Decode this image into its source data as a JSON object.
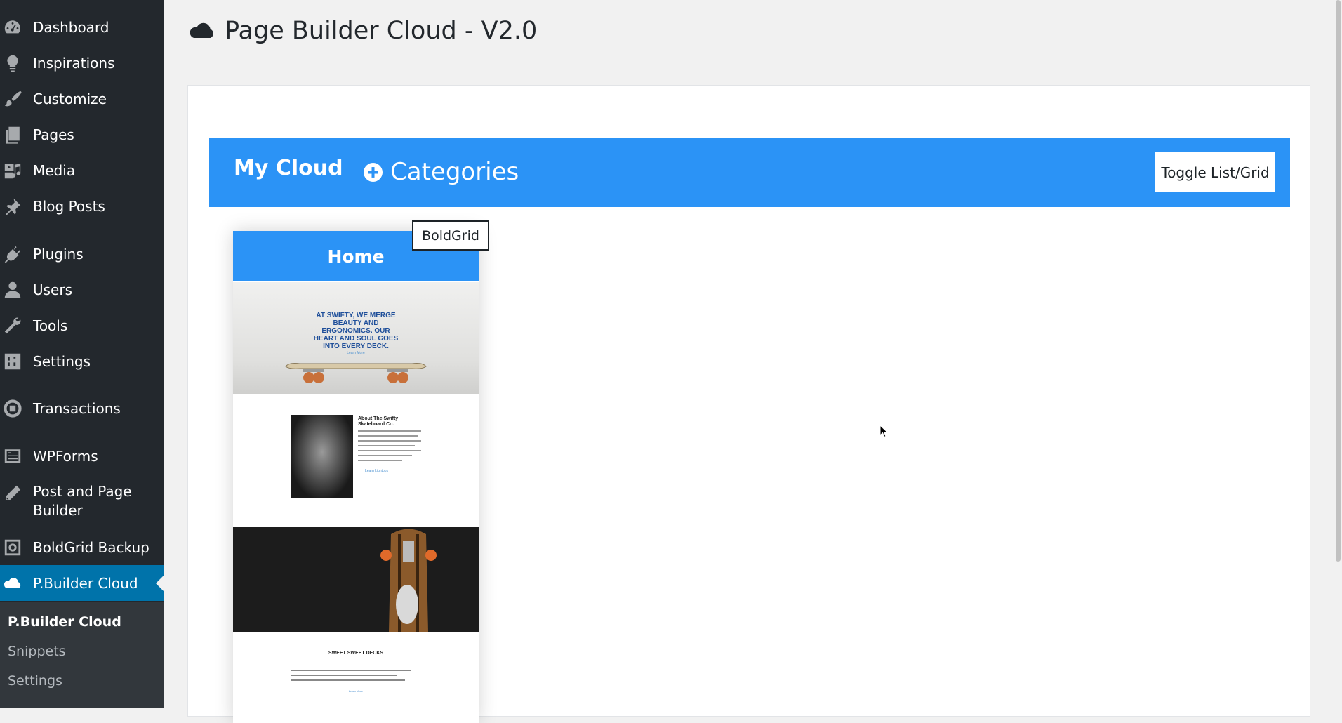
{
  "sidebar": {
    "items": [
      {
        "label": "Dashboard",
        "icon": "dashboard-icon"
      },
      {
        "label": "Inspirations",
        "icon": "lightbulb-icon"
      },
      {
        "label": "Customize",
        "icon": "brush-icon"
      },
      {
        "label": "Pages",
        "icon": "pages-icon"
      },
      {
        "label": "Media",
        "icon": "media-icon"
      },
      {
        "label": "Blog Posts",
        "icon": "pin-icon"
      },
      {
        "label": "Plugins",
        "icon": "plug-icon"
      },
      {
        "label": "Users",
        "icon": "users-icon"
      },
      {
        "label": "Tools",
        "icon": "wrench-icon"
      },
      {
        "label": "Settings",
        "icon": "settings-icon"
      },
      {
        "label": "Transactions",
        "icon": "transactions-icon"
      },
      {
        "label": "WPForms",
        "icon": "forms-icon"
      },
      {
        "label": "Post and Page Builder",
        "label_line1": "Post and Page",
        "label_line2": "Builder",
        "icon": "pencil-icon"
      },
      {
        "label": "BoldGrid Backup",
        "icon": "backup-icon"
      },
      {
        "label": "P.Builder Cloud",
        "icon": "cloud-icon",
        "active": true
      }
    ],
    "submenu": [
      {
        "label": "P.Builder Cloud",
        "current": true
      },
      {
        "label": "Snippets"
      },
      {
        "label": "Settings"
      }
    ]
  },
  "header": {
    "title": "Page Builder Cloud - V2.0",
    "icon": "cloud-icon"
  },
  "cloud_bar": {
    "my_cloud": "My Cloud",
    "categories": "Categories",
    "toggle": "Toggle List/Grid"
  },
  "card": {
    "title": "Home",
    "tag": "BoldGrid",
    "preview": {
      "hero_line1": "AT SWIFTY, WE MERGE",
      "hero_line2": "BEAUTY AND",
      "hero_line3": "ERGONOMICS. OUR",
      "hero_line4": "HEART AND SOUL GOES",
      "hero_line5": "INTO EVERY DECK.",
      "hero_link": "Learn More",
      "about_title_1": "About The Swifty",
      "about_title_2": "Skateboard Co.",
      "about_link": "Learn Lightbox",
      "decks_title": "SWEET SWEET DECKS",
      "decks_link": "Learn More"
    }
  },
  "colors": {
    "sidebar_bg": "#23282d",
    "submenu_bg": "#32373c",
    "active_item": "#0073aa",
    "accent_blue": "#2b93f6",
    "page_bg": "#f1f1f1"
  }
}
